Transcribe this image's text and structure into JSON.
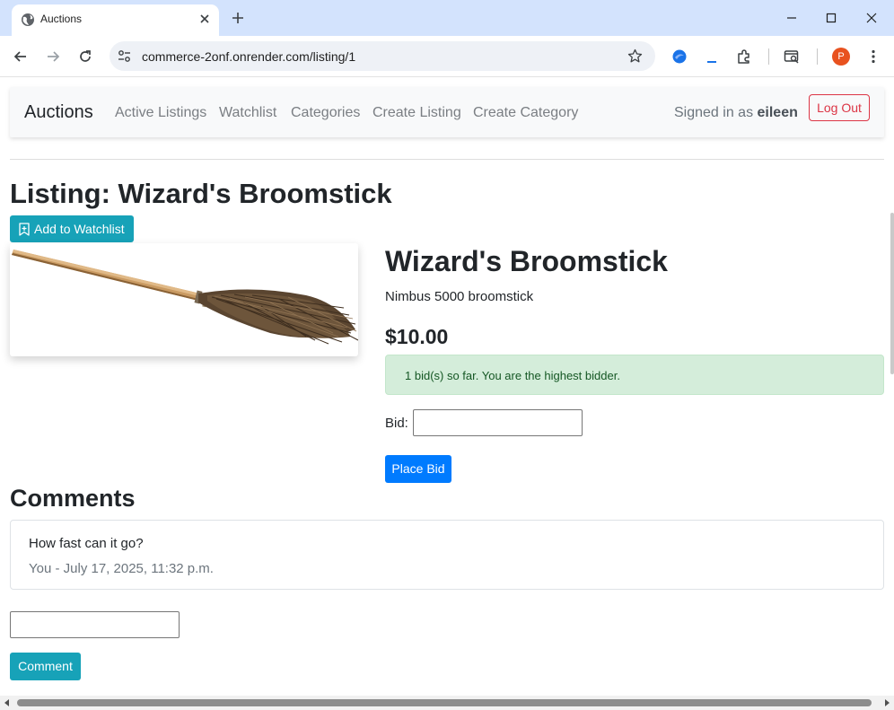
{
  "browser": {
    "tab_title": "Auctions",
    "url": "commerce-2onf.onrender.com/listing/1",
    "profile_initial": "P"
  },
  "navbar": {
    "brand": "Auctions",
    "links": [
      "Active Listings",
      "Watchlist",
      "Categories",
      "Create Listing",
      "Create Category"
    ],
    "signed_in_prefix": "Signed in as",
    "username": "eileen",
    "logout_label": "Log Out"
  },
  "listing": {
    "page_heading": "Listing: Wizard's Broomstick",
    "watchlist_button": "Add to Watchlist",
    "title": "Wizard's Broomstick",
    "description": "Nimbus 5000 broomstick",
    "price": "$10.00",
    "bid_status": "1 bid(s) so far. You are the highest bidder.",
    "bid_label": "Bid:",
    "bid_value": "",
    "place_bid_label": "Place Bid"
  },
  "comments": {
    "heading": "Comments",
    "items": [
      {
        "text": "How fast can it go?",
        "meta": "You - July 17, 2025, 11:32 p.m."
      }
    ],
    "input_value": "",
    "submit_label": "Comment"
  },
  "colors": {
    "info": "#17a2b8",
    "primary": "#007bff",
    "danger": "#dc3545",
    "success_bg": "#d4edda",
    "success_text": "#155724"
  }
}
